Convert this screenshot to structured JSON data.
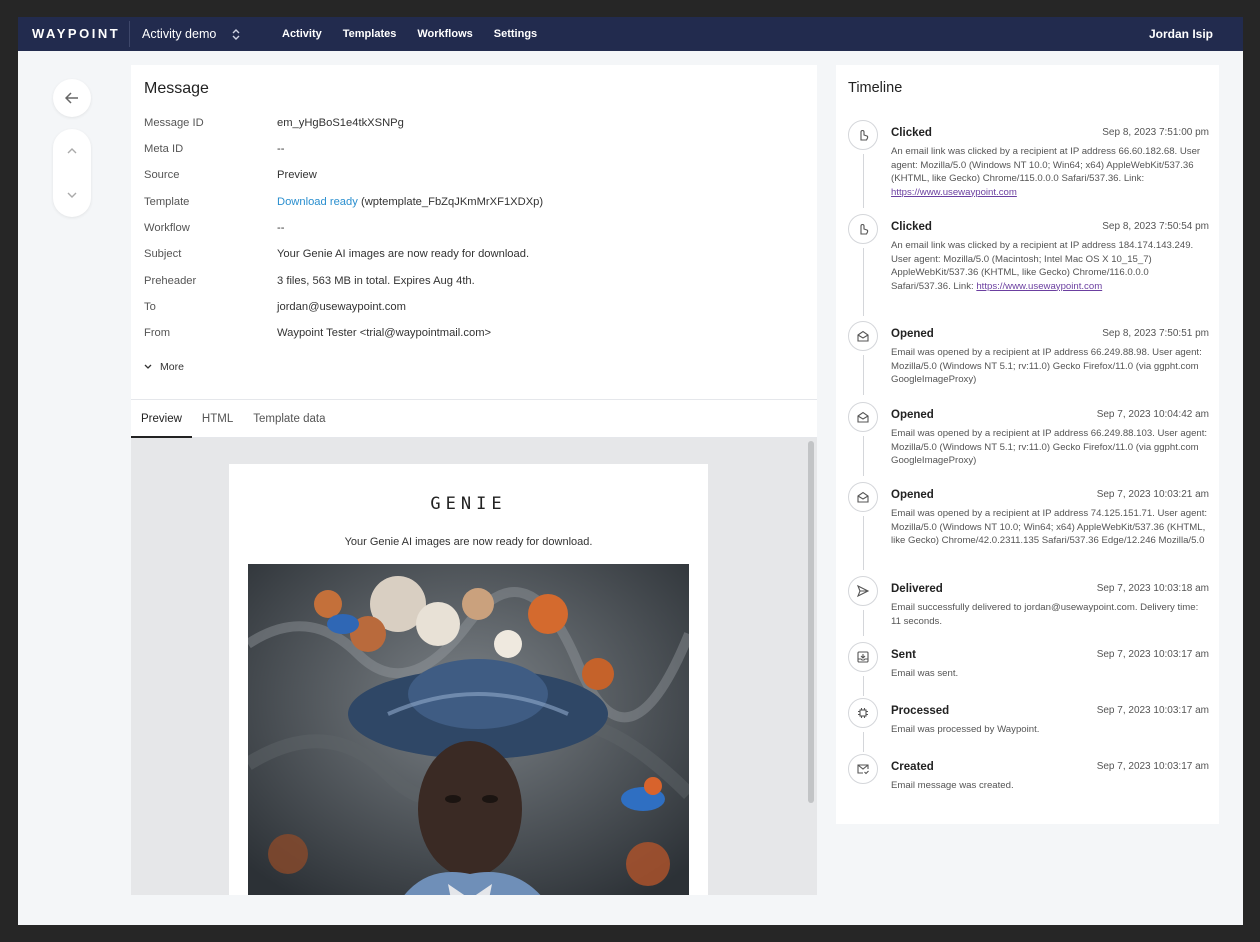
{
  "nav": {
    "brand": "WAYPOINT",
    "project": "Activity demo",
    "links": [
      "Activity",
      "Templates",
      "Workflows",
      "Settings"
    ],
    "user": "Jordan Isip"
  },
  "message": {
    "title": "Message",
    "fields": [
      {
        "label": "Message ID",
        "value": "em_yHgBoS1e4tkXSNPg"
      },
      {
        "label": "Meta ID",
        "value": "--"
      },
      {
        "label": "Source",
        "value": "Preview"
      },
      {
        "label": "Template",
        "link": "Download ready",
        "value": " (wptemplate_FbZqJKmMrXF1XDXp)"
      },
      {
        "label": "Workflow",
        "value": "--"
      },
      {
        "label": "Subject",
        "value": "Your Genie AI images are now ready for download."
      },
      {
        "label": "Preheader",
        "value": "3 files, 563 MB in total. Expires Aug 4th."
      },
      {
        "label": "To",
        "value": "jordan@usewaypoint.com"
      },
      {
        "label": "From",
        "value": "Waypoint Tester <trial@waypointmail.com>"
      }
    ],
    "more": "More",
    "tabs": [
      "Preview",
      "HTML",
      "Template data"
    ],
    "active_tab": "Preview"
  },
  "email_preview": {
    "logo": "GENIE",
    "subtitle": "Your Genie AI images are now ready for download."
  },
  "timeline": {
    "title": "Timeline",
    "events": [
      {
        "name": "Clicked",
        "time": "Sep 8, 2023 7:51:00 pm",
        "icon": "pointer-icon",
        "desc": "An email link was clicked by a recipient at IP address 66.60.182.68. User agent: Mozilla/5.0 (Windows NT 10.0; Win64; x64) AppleWebKit/537.36 (KHTML, like Gecko) Chrome/115.0.0.0 Safari/537.36. Link: ",
        "link": "https://www.usewaypoint.com"
      },
      {
        "name": "Clicked",
        "time": "Sep 8, 2023 7:50:54 pm",
        "icon": "pointer-icon",
        "desc": "An email link was clicked by a recipient at IP address 184.174.143.249. User agent: Mozilla/5.0 (Macintosh; Intel Mac OS X 10_15_7) AppleWebKit/537.36 (KHTML, like Gecko) Chrome/116.0.0.0 Safari/537.36. Link: ",
        "link": "https://www.usewaypoint.com"
      },
      {
        "name": "Opened",
        "time": "Sep 8, 2023 7:50:51 pm",
        "icon": "envelope-open-icon",
        "desc": "Email was opened by a recipient at IP address 66.249.88.98. User agent: Mozilla/5.0 (Windows NT 5.1; rv:11.0) Gecko Firefox/11.0 (via ggpht.com GoogleImageProxy)"
      },
      {
        "name": "Opened",
        "time": "Sep 7, 2023 10:04:42 am",
        "icon": "envelope-open-icon",
        "desc": "Email was opened by a recipient at IP address 66.249.88.103. User agent: Mozilla/5.0 (Windows NT 5.1; rv:11.0) Gecko Firefox/11.0 (via ggpht.com GoogleImageProxy)"
      },
      {
        "name": "Opened",
        "time": "Sep 7, 2023 10:03:21 am",
        "icon": "envelope-open-icon",
        "desc": "Email was opened by a recipient at IP address 74.125.151.71. User agent: Mozilla/5.0 (Windows NT 10.0; Win64; x64) AppleWebKit/537.36 (KHTML, like Gecko) Chrome/42.0.2311.135 Safari/537.36 Edge/12.246 Mozilla/5.0"
      },
      {
        "name": "Delivered",
        "time": "Sep 7, 2023 10:03:18 am",
        "icon": "paper-plane-icon",
        "desc": "Email successfully delivered to jordan@usewaypoint.com. Delivery time: 11 seconds."
      },
      {
        "name": "Sent",
        "time": "Sep 7, 2023 10:03:17 am",
        "icon": "outbox-icon",
        "desc": "Email was sent."
      },
      {
        "name": "Processed",
        "time": "Sep 7, 2023 10:03:17 am",
        "icon": "chip-icon",
        "desc": "Email was processed by Waypoint."
      },
      {
        "name": "Created",
        "time": "Sep 7, 2023 10:03:17 am",
        "icon": "envelope-check-icon",
        "desc": "Email message was created."
      }
    ]
  }
}
